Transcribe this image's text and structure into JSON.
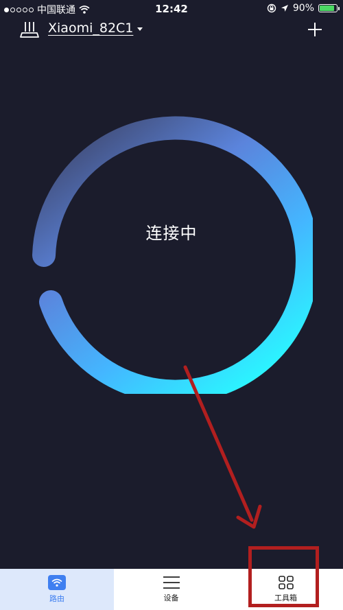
{
  "status_bar": {
    "carrier": "中国联通",
    "time": "12:42",
    "battery_percent": "90%",
    "battery_level": 0.9,
    "signal_bars_filled": 1,
    "signal_bars_total": 5
  },
  "header": {
    "router_name": "Xiaomi_82C1",
    "router_icon": "router-icon",
    "add_icon": "plus-icon"
  },
  "main": {
    "status_text": "连接中",
    "progress_ring_colors": [
      "#3a3e5e",
      "#5b84dc",
      "#44b6ff",
      "#2bf5ff"
    ]
  },
  "tabs": [
    {
      "label": "路由",
      "icon": "wifi-icon",
      "active": true
    },
    {
      "label": "设备",
      "icon": "menu-icon",
      "active": false
    },
    {
      "label": "工具箱",
      "icon": "grid-icon",
      "active": false
    }
  ],
  "colors": {
    "background": "#1b1c2c",
    "accent": "#3f7ff0",
    "annotation": "#b21f1f",
    "battery": "#4cd964"
  }
}
